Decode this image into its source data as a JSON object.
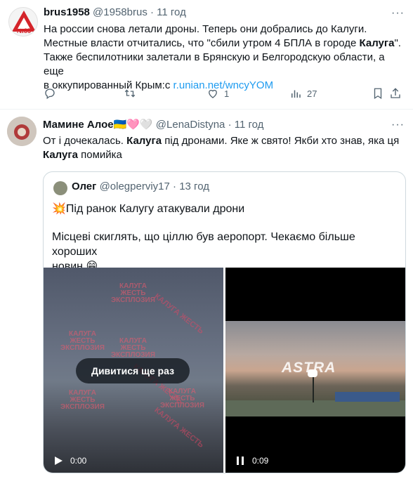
{
  "tweet1": {
    "name": "brus1958",
    "handle": "@1958brus",
    "dot": "·",
    "time": "11 год",
    "avatar_text": "№35",
    "line1": "На россии снова летали дроны. Теперь они добрались до Калуги.",
    "line2_pre": "Местные власти отчитались, что \"сбили утром 4 БПЛА в городе ",
    "line2_bold": "Калуга",
    "line2_post": "\".",
    "line3": "Также беспилотники залетали в Брянскую и Белгородскую области, а еще",
    "line4_pre": "в оккупированный Крым:с ",
    "link": "r.unian.net/wncyYOM",
    "more": "···",
    "actions": {
      "reply": "",
      "retweet": "",
      "like": "1",
      "views": "27"
    }
  },
  "tweet2": {
    "name": "Мамине Алое",
    "emoji": "🇺🇦🩷🤍",
    "handle": "@LenaDistyna",
    "dot": "·",
    "time": "11 год",
    "more": "···",
    "line1_pre": "От і дочекалась. ",
    "line1_bold": "Калуга",
    "line1_post": " під дронами. Яке ж свято! Якби хто знав, яка ця",
    "line2_bold": "Калуга",
    "line2_post": " помийка",
    "quote": {
      "name": "Олег",
      "handle": "@olegperviy17",
      "dot": "·",
      "time": "13 год",
      "line1_emoji": "💥",
      "line1": "Під ранок Калугу атакували дрони",
      "line2": "Місцеві скиглять, що ціллю був аеропорт. Чекаємо більше хороших",
      "line3": "новин",
      "line3_emoji": "😁",
      "video1": {
        "replay": "Дивитися ще раз",
        "time": "0:00",
        "watermark_top": "КАЛУГА",
        "watermark_mid": "ЖЕСТЬ",
        "watermark_bot": "ЭКСПЛОЗИЯ",
        "diag_text": "КАЛУГА ЖЕСТЬ"
      },
      "video2": {
        "time": "0:09",
        "logo": "ASTRA"
      }
    }
  }
}
